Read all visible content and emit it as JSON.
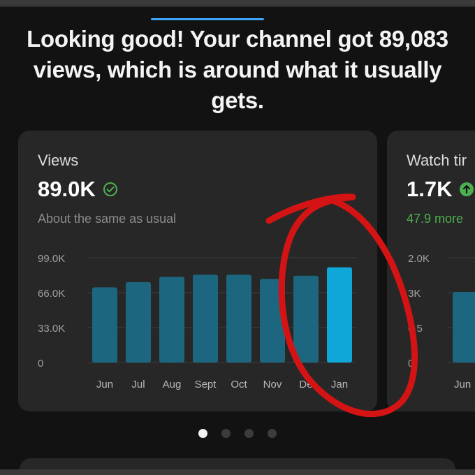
{
  "header": {
    "headline": "Looking good! Your channel got 89,083 views, which is around what it usually gets."
  },
  "cards": [
    {
      "title": "Views",
      "value": "89.0K",
      "status_icon": "check-circle-icon",
      "subtitle": "About the same as usual"
    },
    {
      "title": "Watch tir",
      "value": "1.7K",
      "status_icon": "up-arrow-circle-icon",
      "subtitle": "47.9 more",
      "y_ticks": [
        "2.0K",
        "3K",
        "6 5",
        "0."
      ],
      "x_visible": [
        "Jun"
      ]
    }
  ],
  "pagination": {
    "count": 4,
    "active": 0
  },
  "colors": {
    "bar": "#1d6680",
    "bar_highlight": "#0fa6d8",
    "accent_tab": "#3ea6ff",
    "annotation": "#d41414",
    "positive": "#4caf50"
  },
  "chart_data": {
    "type": "bar",
    "categories": [
      "Jun",
      "Jul",
      "Aug",
      "Sept",
      "Oct",
      "Nov",
      "De",
      "Jan"
    ],
    "values": [
      71000,
      76000,
      81000,
      83000,
      83000,
      79000,
      82000,
      90000
    ],
    "y_ticks": [
      0,
      33000,
      66000,
      99000
    ],
    "y_tick_labels": [
      "0",
      "33.0K",
      "66.0K",
      "99.0K"
    ],
    "ylim": [
      0,
      99000
    ],
    "highlight_index": 7,
    "grid": true
  }
}
